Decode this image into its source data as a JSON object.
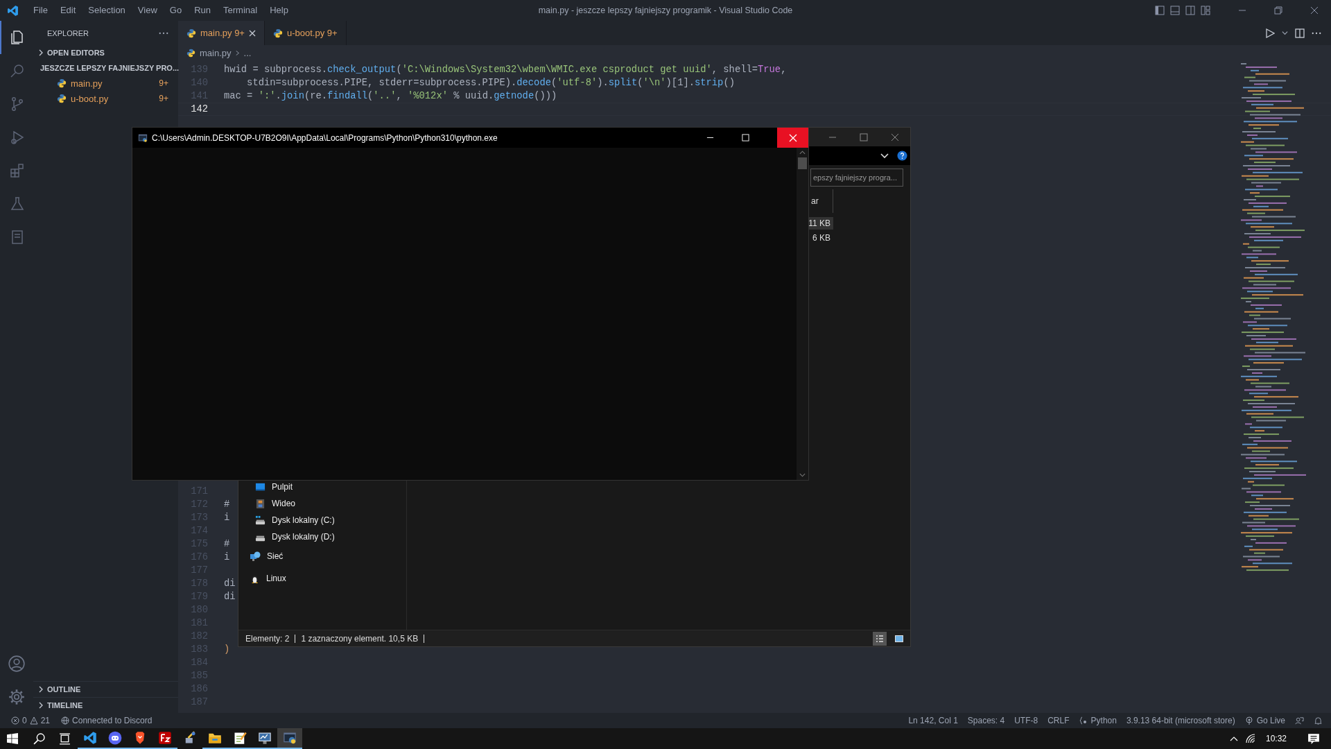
{
  "window": {
    "title": "main.py - jeszcze lepszy fajniejszy programik - Visual Studio Code"
  },
  "menu": [
    "File",
    "Edit",
    "Selection",
    "View",
    "Go",
    "Run",
    "Terminal",
    "Help"
  ],
  "activity_bar": [
    {
      "kind": "files",
      "selected": true
    },
    {
      "kind": "search",
      "selected": false
    },
    {
      "kind": "source-control",
      "selected": false
    },
    {
      "kind": "run",
      "selected": false
    },
    {
      "kind": "extensions",
      "selected": false
    },
    {
      "kind": "testing",
      "selected": false
    },
    {
      "kind": "notebook",
      "selected": false
    }
  ],
  "sidebar": {
    "title": "EXPLORER",
    "sections": [
      {
        "label": "OPEN EDITORS",
        "expanded": false
      },
      {
        "label": "JESZCZE LEPSZY FAJNIEJSZY PRO...",
        "expanded": true,
        "files": [
          {
            "name": "main.py",
            "badge": "9+"
          },
          {
            "name": "u-boot.py",
            "badge": "9+"
          }
        ]
      }
    ],
    "bottom_sections": [
      {
        "label": "OUTLINE",
        "expanded": false
      },
      {
        "label": "TIMELINE",
        "expanded": false
      }
    ]
  },
  "tabs": [
    {
      "label": "main.py",
      "badge": "9+",
      "selected": true
    },
    {
      "label": "u-boot.py",
      "badge": "9+",
      "selected": false
    }
  ],
  "breadcrumb": [
    "main.py",
    "..."
  ],
  "code": {
    "top_lines": [
      {
        "number": "139",
        "current": false,
        "tokens": [
          {
            "t": "hwid = subprocess."
          },
          {
            "t": "check_output",
            "color": "#61afef"
          },
          {
            "t": "("
          },
          {
            "t": "'C:\\Windows\\System32\\wbem\\WMIC.exe csproduct get uuid'",
            "color": "#98c379"
          },
          {
            "t": ", shell="
          },
          {
            "t": "True",
            "color": "#c678dd"
          },
          {
            "t": ","
          }
        ]
      },
      {
        "number": "140",
        "current": false,
        "tokens": [
          {
            "t": "    stdin=subprocess.PIPE, stderr=subprocess.PIPE)."
          },
          {
            "t": "decode",
            "color": "#61afef"
          },
          {
            "t": "("
          },
          {
            "t": "'utf-8'",
            "color": "#98c379"
          },
          {
            "t": ")."
          },
          {
            "t": "split",
            "color": "#61afef"
          },
          {
            "t": "("
          },
          {
            "t": "'\\n'",
            "color": "#98c379"
          },
          {
            "t": ")[1]."
          },
          {
            "t": "strip",
            "color": "#61afef"
          },
          {
            "t": "()"
          }
        ]
      },
      {
        "number": "141",
        "current": false,
        "tokens": [
          {
            "t": "mac = "
          },
          {
            "t": "':'",
            "color": "#98c379"
          },
          {
            "t": "."
          },
          {
            "t": "join",
            "color": "#61afef"
          },
          {
            "t": "(re."
          },
          {
            "t": "findall",
            "color": "#61afef"
          },
          {
            "t": "("
          },
          {
            "t": "'..'",
            "color": "#98c379"
          },
          {
            "t": ", "
          },
          {
            "t": "'%012x'",
            "color": "#98c379"
          },
          {
            "t": " % uuid."
          },
          {
            "t": "getnode",
            "color": "#61afef"
          },
          {
            "t": "()))"
          }
        ]
      },
      {
        "number": "142",
        "current": true
      }
    ],
    "bottom_lines": [
      {
        "number": "171",
        "current": false
      },
      {
        "number": "172",
        "current": false,
        "tokens": [
          {
            "t": "#"
          }
        ]
      },
      {
        "number": "173",
        "current": false,
        "tokens": [
          {
            "t": "i"
          }
        ]
      },
      {
        "number": "174",
        "current": false
      },
      {
        "number": "175",
        "current": false,
        "tokens": [
          {
            "t": "#"
          }
        ]
      },
      {
        "number": "176",
        "current": false,
        "tokens": [
          {
            "t": "i"
          }
        ]
      },
      {
        "number": "177",
        "current": false
      },
      {
        "number": "178",
        "current": false,
        "tokens": [
          {
            "t": "di"
          }
        ]
      },
      {
        "number": "179",
        "current": false,
        "tokens": [
          {
            "t": "di"
          }
        ]
      },
      {
        "number": "180",
        "current": false
      },
      {
        "number": "181",
        "current": false
      },
      {
        "number": "182",
        "current": false
      },
      {
        "number": "183",
        "current": false,
        "tokens": [
          {
            "t": ")",
            "color": "#d19a66"
          }
        ]
      },
      {
        "number": "184",
        "current": false
      },
      {
        "number": "185",
        "current": false
      },
      {
        "number": "186",
        "current": false
      },
      {
        "number": "187",
        "current": false
      }
    ]
  },
  "console_window": {
    "title": "C:\\Users\\Admin.DESKTOP-U7B2O9I\\AppData\\Local\\Programs\\Python\\Python310\\python.exe"
  },
  "file_explorer": {
    "search_placeholder": "epszy fajniejszy progra...",
    "column": "ar",
    "sizes": [
      {
        "text": "11 KB",
        "selected": true
      },
      {
        "text": "6 KB",
        "selected": false
      }
    ],
    "nav": [
      {
        "label": "Pulpit",
        "kind": "desktop"
      },
      {
        "label": "Wideo",
        "kind": "video"
      },
      {
        "label": "Dysk lokalny (C:)",
        "kind": "drive-system"
      },
      {
        "label": "Dysk lokalny (D:)",
        "kind": "drive"
      },
      {
        "label": "Sieć",
        "kind": "network"
      },
      {
        "label": "Linux",
        "kind": "linux"
      }
    ],
    "status": [
      "Elementy: 2",
      "1 zaznaczony element. 10,5 KB"
    ],
    "view_buttons": [
      {
        "kind": "details",
        "selected": true
      },
      {
        "kind": "tiles",
        "selected": false
      }
    ]
  },
  "status_bar": {
    "errors": "0",
    "warnings": "21",
    "discord": "Connected to Discord",
    "right": [
      {
        "kind": "text",
        "label": "Ln 142, Col 1"
      },
      {
        "kind": "text",
        "label": "Spaces: 4"
      },
      {
        "kind": "text",
        "label": "UTF-8"
      },
      {
        "kind": "text",
        "label": "CRLF"
      },
      {
        "kind": "language",
        "label": "Python"
      },
      {
        "kind": "text",
        "label": "3.9.13 64-bit (microsoft store)"
      },
      {
        "kind": "live",
        "label": "Go Live"
      }
    ]
  },
  "taskbar": {
    "apps": [
      {
        "kind": "vscode",
        "running": true,
        "selected": false
      },
      {
        "kind": "discord",
        "running": true,
        "selected": false
      },
      {
        "kind": "brave",
        "running": true,
        "selected": false
      },
      {
        "kind": "filezilla",
        "running": true,
        "selected": false
      },
      {
        "kind": "tool",
        "running": false,
        "selected": false
      },
      {
        "kind": "folder",
        "running": true,
        "selected": false
      },
      {
        "kind": "notepad",
        "running": true,
        "selected": false
      },
      {
        "kind": "monitor",
        "running": true,
        "selected": false
      },
      {
        "kind": "python",
        "running": true,
        "selected": true
      }
    ],
    "clock": "10:32"
  }
}
